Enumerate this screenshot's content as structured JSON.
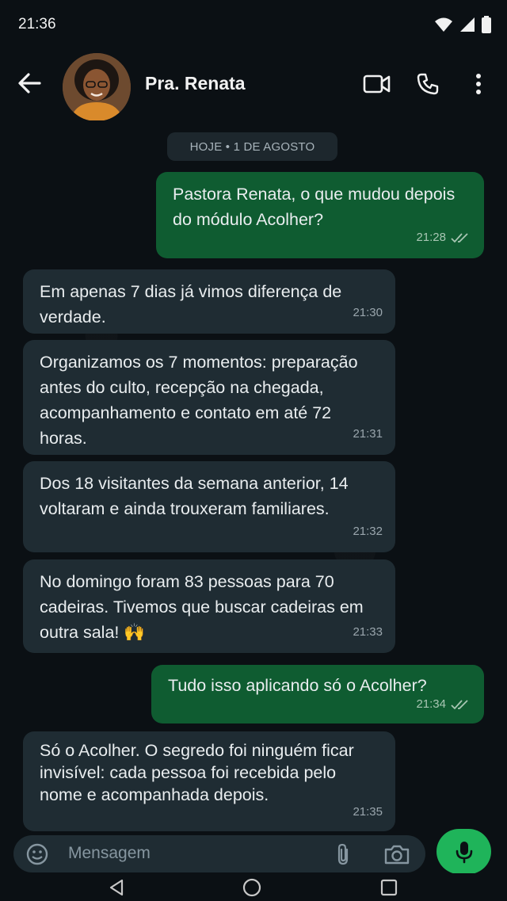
{
  "status_bar": {
    "time": "21:36"
  },
  "header": {
    "contact_name": "Pra. Renata"
  },
  "chat": {
    "date_chip": "HOJE • 1 DE AGOSTO",
    "messages": [
      {
        "direction": "out",
        "text": "Pastora Renata, o que mudou depois do módulo Acolher?",
        "time": "21:28",
        "read": true
      },
      {
        "direction": "in",
        "text": "Em apenas 7 dias já vimos diferença de verdade.",
        "time": "21:30"
      },
      {
        "direction": "in",
        "text": "Organizamos os 7 momentos: preparação antes do culto, recepção na chegada, acompanhamento e contato em até 72 horas.",
        "time": "21:31"
      },
      {
        "direction": "in",
        "text": "Dos 18 visitantes da semana anterior, 14 voltaram e ainda trouxeram familiares.",
        "time": "21:32"
      },
      {
        "direction": "in",
        "text": "No domingo foram 83 pessoas para 70 cadeiras. Tivemos que buscar cadeiras em outra sala! 🙌",
        "time": "21:33"
      },
      {
        "direction": "out",
        "text": "Tudo isso aplicando só o Acolher?",
        "time": "21:34",
        "read": true
      },
      {
        "direction": "in",
        "text": "Só o Acolher. O segredo foi ninguém ficar invisível: cada pessoa foi recebida pelo nome e acompanhada depois.",
        "time": "21:35"
      }
    ]
  },
  "composer": {
    "placeholder": "Mensagem"
  },
  "colors": {
    "incoming_bubble": "#1f2c33",
    "outgoing_bubble": "#0f5c31",
    "accent": "#1fb45a",
    "background": "#0b1014"
  }
}
